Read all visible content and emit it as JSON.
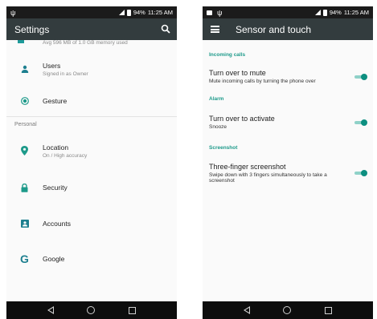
{
  "status_bar": {
    "battery": "94%",
    "time": "11:25 AM"
  },
  "left_screen": {
    "title": "Settings",
    "clipped_text": "Avg 596 MB of 1.0 GB memory used",
    "items": [
      {
        "icon": "person-icon",
        "title": "Users",
        "subtitle": "Signed in as Owner"
      },
      {
        "icon": "gesture-icon",
        "title": "Gesture",
        "subtitle": ""
      }
    ],
    "section": "Personal",
    "personal_items": [
      {
        "icon": "location-pin-icon",
        "title": "Location",
        "subtitle": "On / High accuracy"
      },
      {
        "icon": "lock-icon",
        "title": "Security",
        "subtitle": ""
      },
      {
        "icon": "account-box-icon",
        "title": "Accounts",
        "subtitle": ""
      },
      {
        "icon": "google-icon",
        "title": "Google",
        "subtitle": ""
      }
    ]
  },
  "right_screen": {
    "title": "Sensor and touch",
    "categories": [
      {
        "label": "Incoming calls",
        "setting": {
          "title": "Turn over to mute",
          "subtitle": "Mute incoming calls by turning the phone over",
          "enabled": true
        }
      },
      {
        "label": "Alarm",
        "setting": {
          "title": "Turn over to activate",
          "subtitle": "Snooze",
          "enabled": true
        }
      },
      {
        "label": "Screenshot",
        "setting": {
          "title": "Three-finger screenshot",
          "subtitle": "Swipe down with 3 fingers simultaneously to take a screenshot",
          "enabled": true
        }
      }
    ]
  },
  "colors": {
    "app_bar": "#333c3e",
    "accent": "#1d9a8a",
    "status_bar": "#1b1b1b",
    "nav_bar": "#0d0d0d"
  }
}
